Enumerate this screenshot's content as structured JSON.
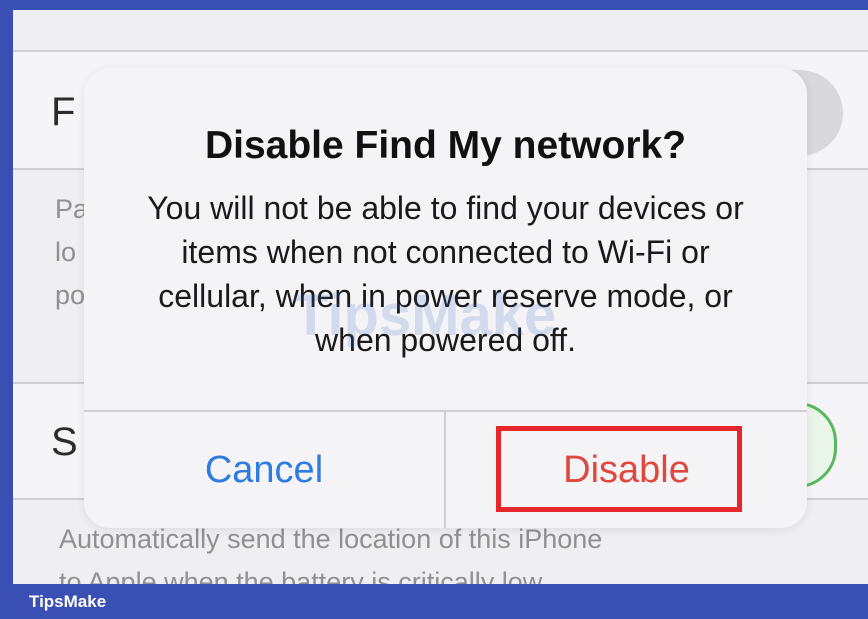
{
  "background": {
    "row1_text": "F",
    "row1_sub": [
      "Pa",
      "lo",
      "po"
    ],
    "row2_text": "S",
    "row2_sub": "Automatically send the location of this iPhone",
    "row2_sub2": "to Apple when the battery is critically low."
  },
  "dialog": {
    "title": "Disable Find My network?",
    "message": "You will not be able to find your devices or items when not connected to Wi-Fi or cellular, when in power reserve mode, or when powered off.",
    "cancel_label": "Cancel",
    "disable_label": "Disable"
  },
  "watermark": "TipsMake",
  "footer": {
    "brand": "TipsMake"
  },
  "colors": {
    "frame": "#3a4fb3",
    "cancel": "#2f7be0",
    "disable": "#e0473e",
    "highlight": "#e5262b"
  }
}
